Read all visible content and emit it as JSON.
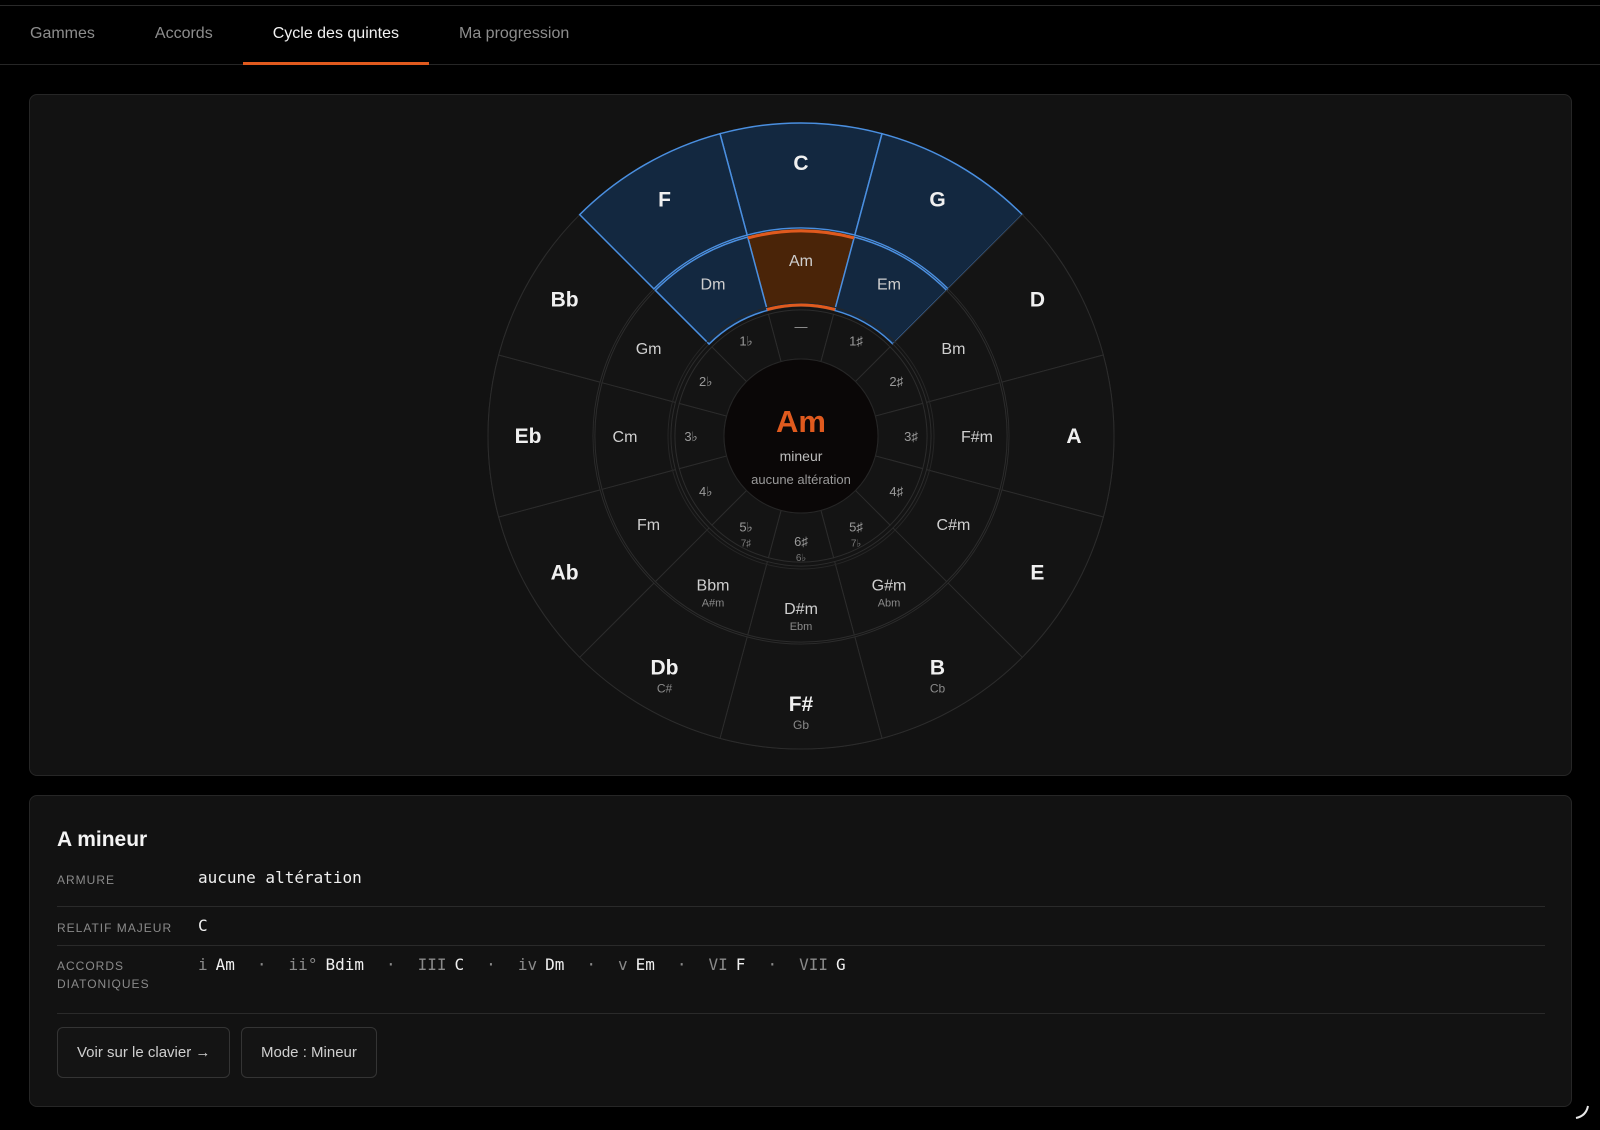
{
  "tabs": [
    {
      "label": "Gammes",
      "active": false
    },
    {
      "label": "Accords",
      "active": false
    },
    {
      "label": "Cycle des quintes",
      "active": true
    },
    {
      "label": "Ma progression",
      "active": false
    }
  ],
  "wheel": {
    "center": {
      "title": "Am",
      "mode": "mineur",
      "signature": "aucune altération"
    },
    "majors": [
      {
        "name": "C",
        "alt": ""
      },
      {
        "name": "G",
        "alt": ""
      },
      {
        "name": "D",
        "alt": ""
      },
      {
        "name": "A",
        "alt": ""
      },
      {
        "name": "E",
        "alt": ""
      },
      {
        "name": "B",
        "alt": "Cb"
      },
      {
        "name": "F#",
        "alt": "Gb"
      },
      {
        "name": "Db",
        "alt": "C#"
      },
      {
        "name": "Ab",
        "alt": ""
      },
      {
        "name": "Eb",
        "alt": ""
      },
      {
        "name": "Bb",
        "alt": ""
      },
      {
        "name": "F",
        "alt": ""
      }
    ],
    "minors": [
      {
        "name": "Am",
        "alt": ""
      },
      {
        "name": "Em",
        "alt": ""
      },
      {
        "name": "Bm",
        "alt": ""
      },
      {
        "name": "F#m",
        "alt": ""
      },
      {
        "name": "C#m",
        "alt": ""
      },
      {
        "name": "G#m",
        "alt": "Abm"
      },
      {
        "name": "D#m",
        "alt": "Ebm"
      },
      {
        "name": "Bbm",
        "alt": "A#m"
      },
      {
        "name": "Fm",
        "alt": ""
      },
      {
        "name": "Cm",
        "alt": ""
      },
      {
        "name": "Gm",
        "alt": ""
      },
      {
        "name": "Dm",
        "alt": ""
      }
    ],
    "signatures": [
      {
        "main": "—",
        "alt": ""
      },
      {
        "main": "1♯",
        "alt": ""
      },
      {
        "main": "2♯",
        "alt": ""
      },
      {
        "main": "3♯",
        "alt": ""
      },
      {
        "main": "4♯",
        "alt": ""
      },
      {
        "main": "5♯",
        "alt": "7♭"
      },
      {
        "main": "6♯",
        "alt": "6♭"
      },
      {
        "main": "5♭",
        "alt": "7♯"
      },
      {
        "main": "4♭",
        "alt": ""
      },
      {
        "main": "3♭",
        "alt": ""
      },
      {
        "main": "2♭",
        "alt": ""
      },
      {
        "main": "1♭",
        "alt": ""
      }
    ],
    "selected_index": 0,
    "highlighted_indices": [
      11,
      0,
      1
    ],
    "colors": {
      "accent": "#e05a1e",
      "selected_fill": "#4a2408",
      "highlight_fill": "#132840",
      "highlight_stroke": "#4a8fe0",
      "segment_stroke": "#2c2c2c"
    }
  },
  "info": {
    "title": "A mineur",
    "armure_label": "ARMURE",
    "armure_value": "aucune altération",
    "relatif_label": "RELATIF MAJEUR",
    "relatif_value": "C",
    "accords_label": "ACCORDS DIATONIQUES",
    "chords": [
      {
        "degree": "i",
        "chord": "Am"
      },
      {
        "degree": "ii°",
        "chord": "Bdim"
      },
      {
        "degree": "III",
        "chord": "C"
      },
      {
        "degree": "iv",
        "chord": "Dm"
      },
      {
        "degree": "v",
        "chord": "Em"
      },
      {
        "degree": "VI",
        "chord": "F"
      },
      {
        "degree": "VII",
        "chord": "G"
      }
    ],
    "separator": "·",
    "btn_keyboard": "Voir sur le clavier →",
    "btn_mode": "Mode : Mineur"
  }
}
